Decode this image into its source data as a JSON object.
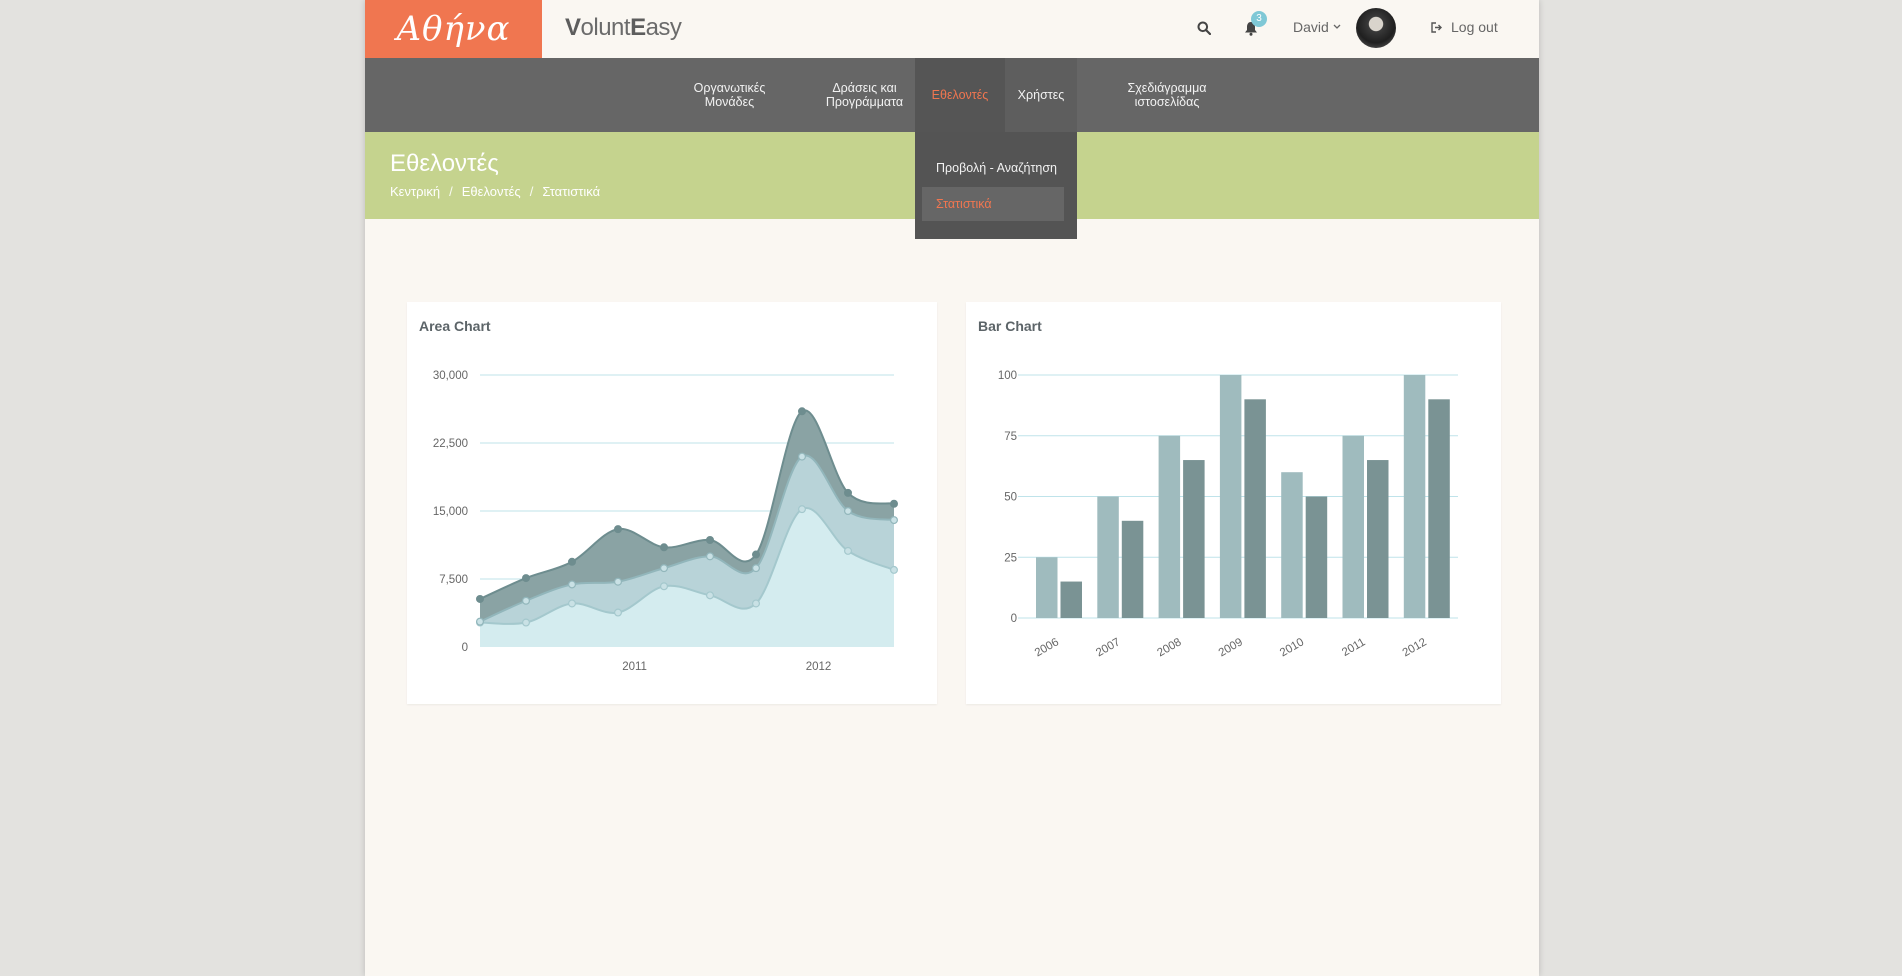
{
  "header": {
    "logo_text": "Αθήνα",
    "brand_first": "V",
    "brand_mid": "olunt",
    "brand_second": "E",
    "brand_last": "asy",
    "notification_count": "3",
    "username": "David",
    "logout_label": "Log out"
  },
  "nav": {
    "items": [
      {
        "line1": "Οργανωτικές",
        "line2": "Μονάδες"
      },
      {
        "line1": "Δράσεις και",
        "line2": "Προγράμματα"
      },
      {
        "line1": "Εθελοντές",
        "line2": ""
      },
      {
        "line1": "Χρήστες",
        "line2": ""
      },
      {
        "line1": "Σχεδιάγραμμα",
        "line2": "ιστοσελίδας"
      }
    ],
    "dropdown": [
      "Προβολή - Αναζήτηση",
      "Στατιστικά"
    ]
  },
  "banner": {
    "title": "Εθελοντές",
    "breadcrumb": [
      "Κεντρική",
      "Εθελοντές",
      "Στατιστικά"
    ],
    "separator": "/"
  },
  "colors": {
    "accent": "#f07650",
    "nav_bg": "#666666",
    "banner_bg": "#c5d38e",
    "series_dark": "#8aa3a4",
    "series_mid": "#b8d3d8",
    "series_light": "#d4ecef",
    "bar_light": "#9fbbbe",
    "bar_dark": "#7a9394"
  },
  "chart_data": [
    {
      "type": "area",
      "title": "Area Chart",
      "xlabel": "",
      "ylabel": "",
      "ylim": [
        0,
        30000
      ],
      "yticks": [
        "0",
        "7,500",
        "15,000",
        "22,500",
        "30,000"
      ],
      "x_tick_labels": [
        "2011",
        "2012"
      ],
      "x": [
        0,
        1,
        2,
        3,
        4,
        5,
        6,
        7,
        8,
        9
      ],
      "series": [
        {
          "values": [
            2700,
            2700,
            4800,
            3800,
            6700,
            5700,
            4800,
            15200,
            10600,
            8500
          ]
        },
        {
          "values": [
            2800,
            5100,
            6900,
            7200,
            8700,
            10000,
            8700,
            21000,
            15000,
            14000
          ]
        },
        {
          "values": [
            5300,
            7600,
            9400,
            13000,
            11000,
            11800,
            10200,
            26000,
            17000,
            15800
          ]
        }
      ],
      "grid": true
    },
    {
      "type": "bar",
      "title": "Bar Chart",
      "xlabel": "",
      "ylabel": "",
      "ylim": [
        0,
        100
      ],
      "yticks": [
        "0",
        "25",
        "50",
        "75",
        "100"
      ],
      "categories": [
        "2006",
        "2007",
        "2008",
        "2009",
        "2010",
        "2011",
        "2012"
      ],
      "series": [
        {
          "values": [
            25,
            50,
            75,
            100,
            60,
            75,
            100
          ]
        },
        {
          "values": [
            15,
            40,
            65,
            90,
            50,
            65,
            90
          ]
        }
      ],
      "grid": true
    }
  ]
}
